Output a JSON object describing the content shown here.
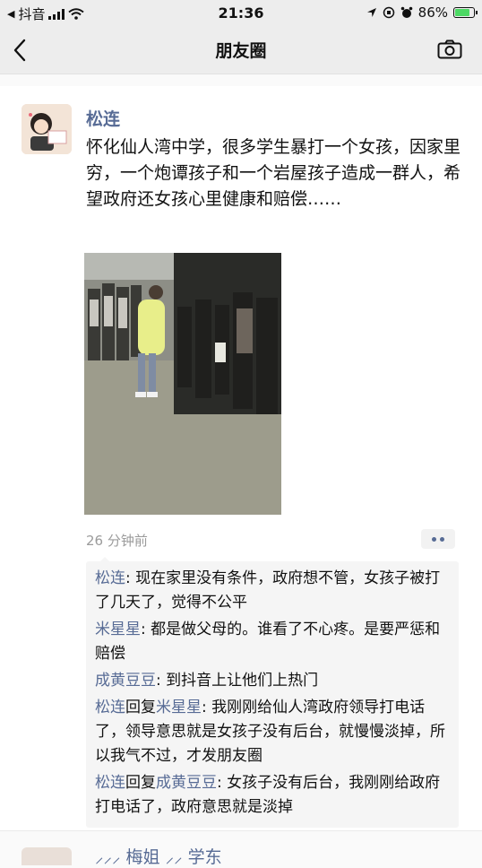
{
  "status_bar": {
    "back_app": "抖音",
    "time": "21:36",
    "battery": "86%",
    "battery_level": 0.86,
    "signal_icon": "cellular-signal-icon",
    "wifi_icon": "wifi-icon",
    "location_icon": "location-arrow-icon",
    "alarm_icon": "alarm-icon"
  },
  "nav": {
    "title": "朋友圈",
    "back_icon": "chevron-left-icon",
    "camera_icon": "camera-icon"
  },
  "post": {
    "author": "松连",
    "content": "怀化仙人湾中学，很多学生暴打一个女孩，因家里穷，一个炮谭孩子和一个岩屋孩子造成一群人，希望政府还女孩心里健康和赔偿……",
    "time": "26 分钟前",
    "more_icon": "more-dots-icon",
    "comments": [
      {
        "author": "松连",
        "reply_word": "",
        "reply_to": "",
        "text": ": 现在家里没有条件，政府想不管，女孩子被打了几天了，觉得不公平"
      },
      {
        "author": "米星星",
        "reply_word": "",
        "reply_to": "",
        "text": ": 都是做父母的。谁看了不心疼。是要严惩和赔偿"
      },
      {
        "author": "成黄豆豆",
        "reply_word": "",
        "reply_to": "",
        "text": ": 到抖音上让他们上热门"
      },
      {
        "author": "松连",
        "reply_word": "回复",
        "reply_to": "米星星",
        "text": ": 我刚刚给仙人湾政府领导打电话了，领导意思就是女孩子没有后台，就慢慢淡掉，所以我气不过，才发朋友圈"
      },
      {
        "author": "松连",
        "reply_word": "回复",
        "reply_to": "成黄豆豆",
        "text": ": 女孩子没有后台，我刚刚给政府打电话了，政府意思就是淡掉"
      }
    ]
  },
  "next_post": {
    "author": "⸝⸝⸝ 梅姐 ⸝⸝ 学东"
  },
  "colors": {
    "link": "#576b95",
    "bar_bg": "#ededed",
    "comment_bg": "#f5f5f5"
  }
}
